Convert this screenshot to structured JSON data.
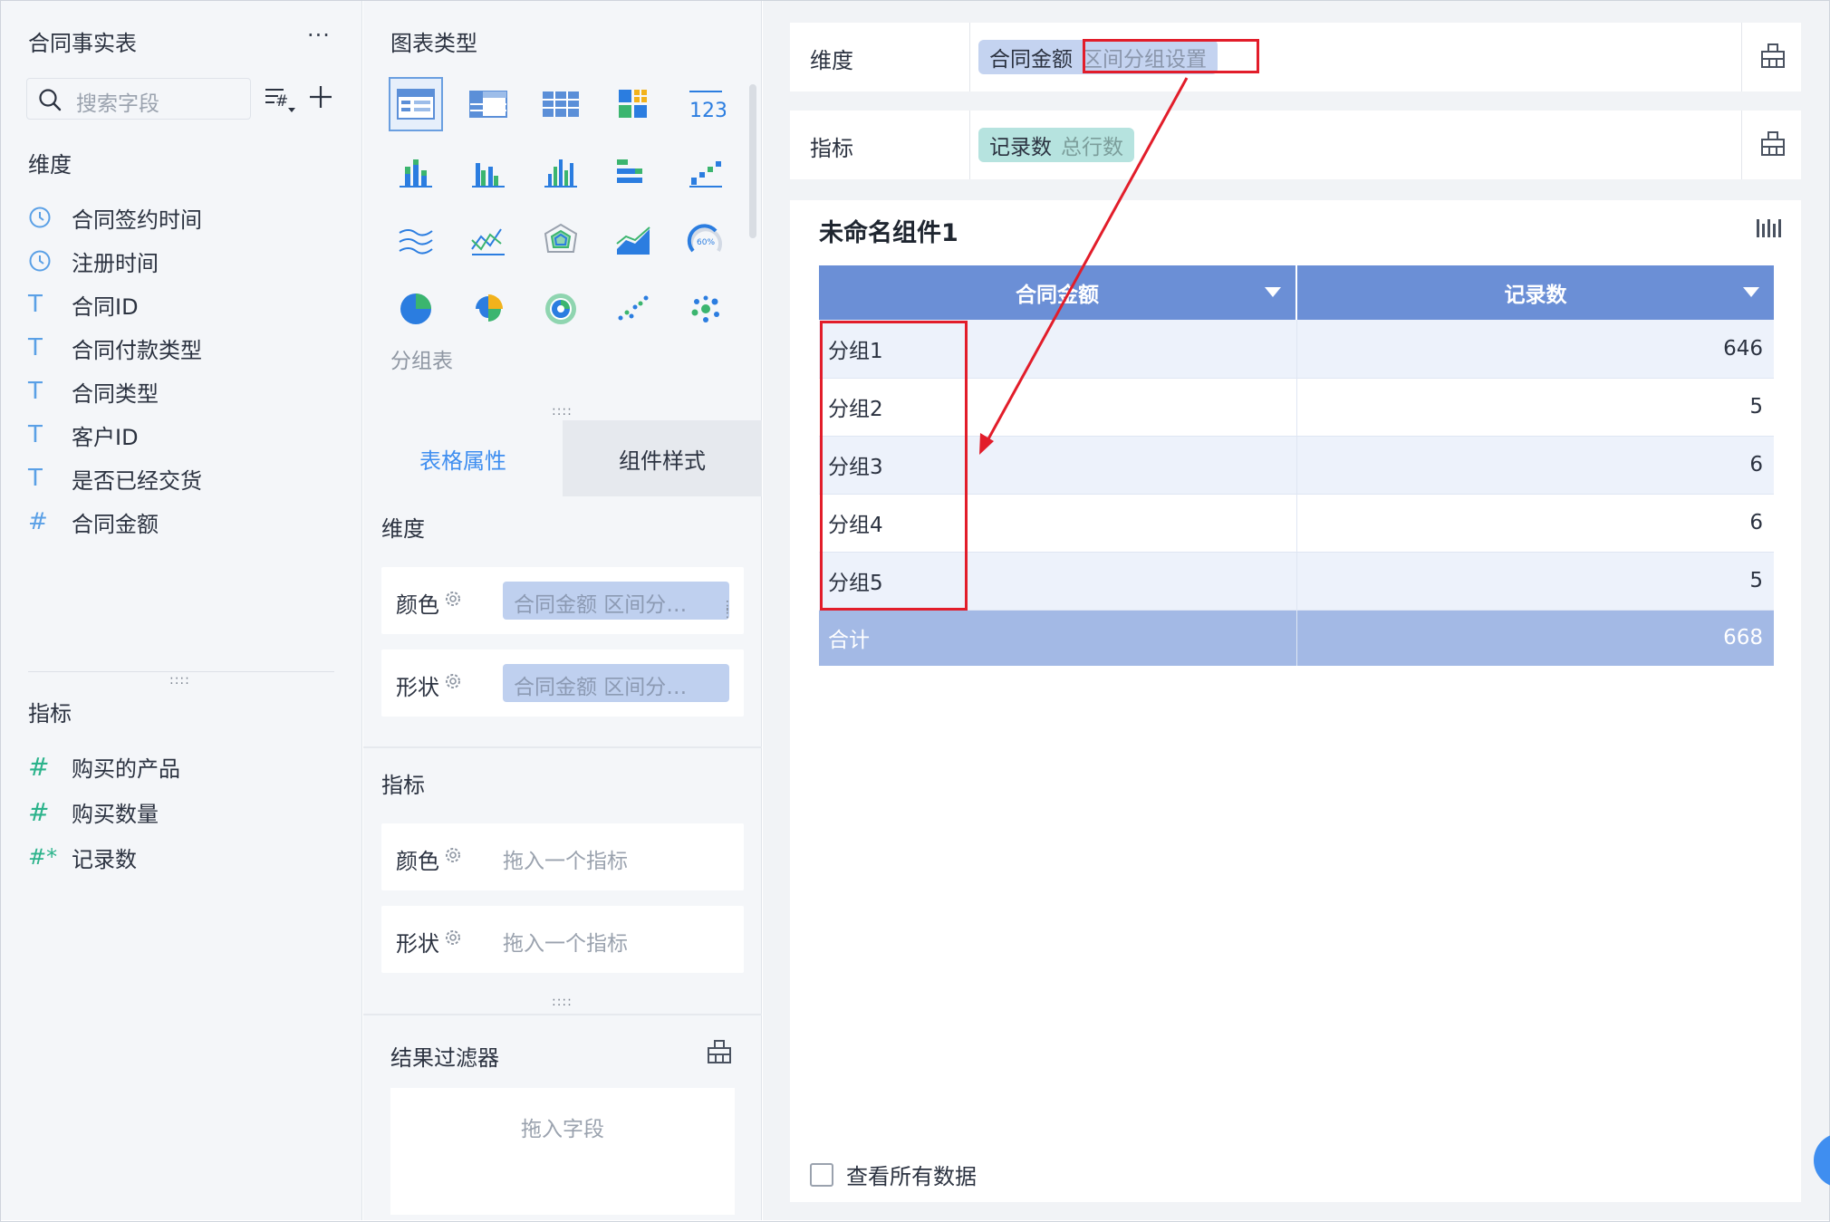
{
  "left_panel": {
    "title": "合同事实表",
    "more": "···",
    "search": {
      "placeholder": "搜索字段"
    },
    "dimensions_title": "维度",
    "dimensions": [
      {
        "label": "合同签约时间",
        "icon": "clock-icon",
        "glyph": ""
      },
      {
        "label": "注册时间",
        "icon": "clock-icon",
        "glyph": ""
      },
      {
        "label": "合同ID",
        "icon": "text-field-icon",
        "glyph": "T"
      },
      {
        "label": "合同付款类型",
        "icon": "text-field-icon",
        "glyph": "T"
      },
      {
        "label": "合同类型",
        "icon": "text-field-icon",
        "glyph": "T"
      },
      {
        "label": "客户ID",
        "icon": "text-field-icon",
        "glyph": "T"
      },
      {
        "label": "是否已经交货",
        "icon": "text-field-icon",
        "glyph": "T"
      },
      {
        "label": "合同金额",
        "icon": "number-field-icon",
        "glyph": "#"
      }
    ],
    "metrics_title": "指标",
    "metrics": [
      {
        "label": "购买的产品",
        "icon": "number-field-icon",
        "glyph": "#"
      },
      {
        "label": "购买数量",
        "icon": "number-field-icon",
        "glyph": "#"
      },
      {
        "label": "记录数",
        "icon": "count-field-icon",
        "glyph": "#*"
      }
    ]
  },
  "middle_panel": {
    "chart_types_title": "图表类型",
    "selected_chart_label": "分组表",
    "tabs": [
      {
        "label": "表格属性",
        "active": true
      },
      {
        "label": "组件样式",
        "active": false
      }
    ],
    "dimension_section": {
      "title": "维度",
      "rows": [
        {
          "label": "颜色",
          "value": "合同金额 区间分…"
        },
        {
          "label": "形状",
          "value": "合同金额 区间分…"
        }
      ]
    },
    "metric_section": {
      "title": "指标",
      "rows": [
        {
          "label": "颜色",
          "placeholder": "拖入一个指标"
        },
        {
          "label": "形状",
          "placeholder": "拖入一个指标"
        }
      ]
    },
    "result_filter": {
      "title": "结果过滤器",
      "placeholder": "拖入字段"
    }
  },
  "right_panel": {
    "dimension_slot": {
      "label": "维度",
      "chip": "合同金额",
      "chip_sub": "区间分组设置"
    },
    "metric_slot": {
      "label": "指标",
      "chip": "记录数",
      "chip_sub": "总行数"
    },
    "widget": {
      "title": "未命名组件1",
      "columns": [
        "合同金额",
        "记录数"
      ],
      "rows": [
        {
          "group": "分组1",
          "count": "646"
        },
        {
          "group": "分组2",
          "count": "5"
        },
        {
          "group": "分组3",
          "count": "6"
        },
        {
          "group": "分组4",
          "count": "6"
        },
        {
          "group": "分组5",
          "count": "5"
        }
      ],
      "total": {
        "label": "合计",
        "value": "668"
      },
      "view_all": "查看所有数据"
    }
  },
  "colors": {
    "accent": "#3f8ef0",
    "header_blue": "#6b8fd6",
    "total_row": "#a3b9e5",
    "annotation_red": "#e21d2a",
    "dimension_chip": "#c4d3f0",
    "metric_chip": "#b6e3df"
  }
}
